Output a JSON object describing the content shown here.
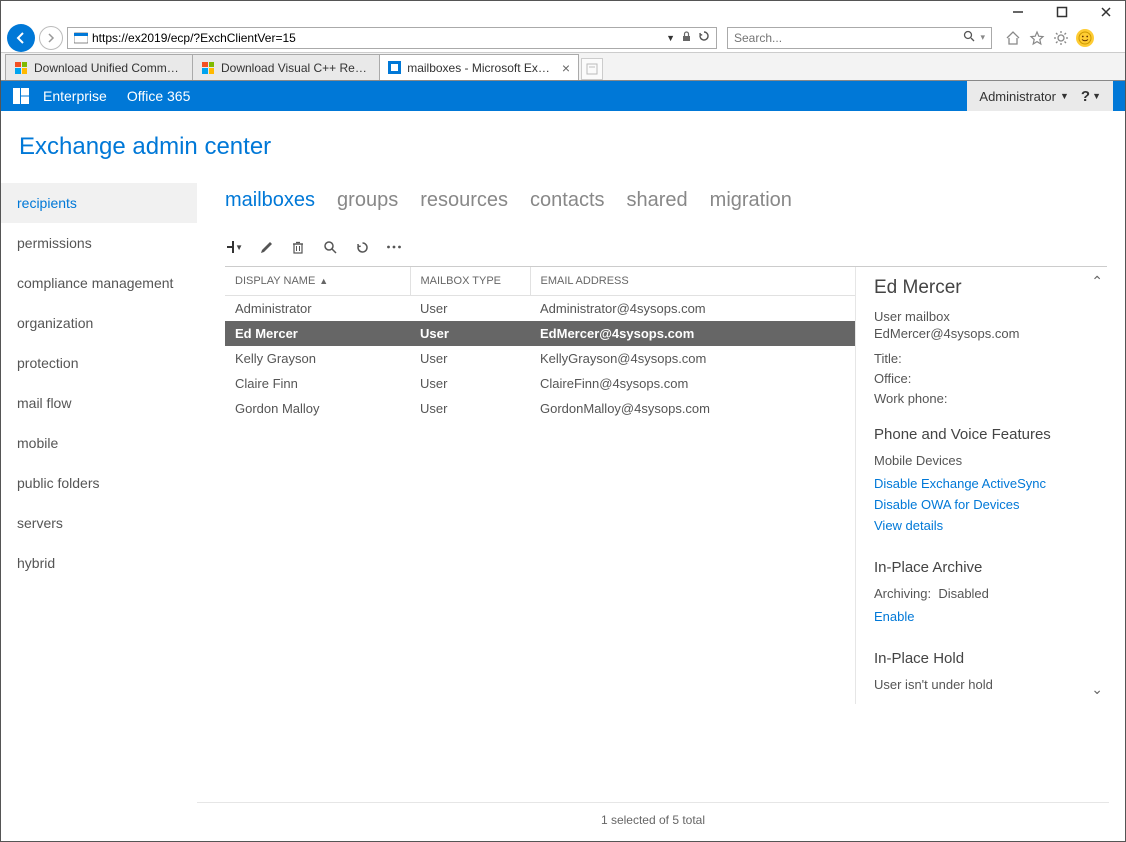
{
  "window": {
    "minimize": "—",
    "maximize": "☐",
    "close": "✕"
  },
  "browser": {
    "url": "https://ex2019/ecp/?ExchClientVer=15",
    "search_placeholder": "Search..."
  },
  "tabs": [
    {
      "title": "Download Unified Communic...",
      "favicon": "ms",
      "active": false
    },
    {
      "title": "Download Visual C++ Redistri...",
      "favicon": "ms",
      "active": false
    },
    {
      "title": "mailboxes - Microsoft Exch...",
      "favicon": "ecp",
      "active": true
    }
  ],
  "o365": {
    "nav": [
      "Enterprise",
      "Office 365"
    ],
    "admin_label": "Administrator",
    "help": "?"
  },
  "eac_title": "Exchange admin center",
  "sidebar": [
    "recipients",
    "permissions",
    "compliance management",
    "organization",
    "protection",
    "mail flow",
    "mobile",
    "public folders",
    "servers",
    "hybrid"
  ],
  "sidebar_active": 0,
  "subtabs": [
    "mailboxes",
    "groups",
    "resources",
    "contacts",
    "shared",
    "migration"
  ],
  "subtab_active": 0,
  "table": {
    "columns": [
      "DISPLAY NAME",
      "MAILBOX TYPE",
      "EMAIL ADDRESS"
    ],
    "sort_col": 0,
    "rows": [
      {
        "name": "Administrator",
        "type": "User",
        "email": "Administrator@4sysops.com",
        "selected": false
      },
      {
        "name": "Ed Mercer",
        "type": "User",
        "email": "EdMercer@4sysops.com",
        "selected": true
      },
      {
        "name": "Kelly Grayson",
        "type": "User",
        "email": "KellyGrayson@4sysops.com",
        "selected": false
      },
      {
        "name": "Claire Finn",
        "type": "User",
        "email": "ClaireFinn@4sysops.com",
        "selected": false
      },
      {
        "name": "Gordon Malloy",
        "type": "User",
        "email": "GordonMalloy@4sysops.com",
        "selected": false
      }
    ]
  },
  "details": {
    "name": "Ed Mercer",
    "type": "User mailbox",
    "email": "EdMercer@4sysops.com",
    "title_label": "Title:",
    "office_label": "Office:",
    "workphone_label": "Work phone:",
    "phone_section": "Phone and Voice Features",
    "mobile_label": "Mobile Devices",
    "link_activesync": "Disable Exchange ActiveSync",
    "link_owa": "Disable OWA for Devices",
    "link_viewdetails": "View details",
    "archive_section": "In-Place Archive",
    "archiving_label": "Archiving:",
    "archiving_value": "Disabled",
    "link_enable": "Enable",
    "hold_section": "In-Place Hold",
    "hold_status": "User isn't under hold"
  },
  "footer": "1 selected of 5 total"
}
